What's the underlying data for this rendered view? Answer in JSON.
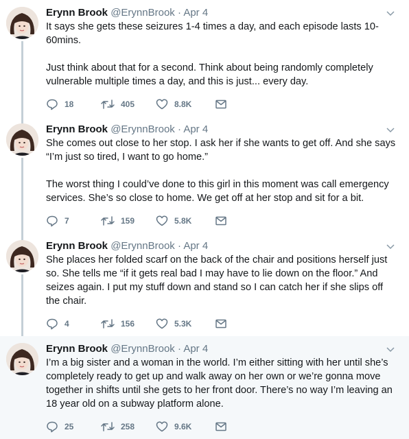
{
  "tweets": [
    {
      "name": "Erynn Brook",
      "handle": "@ErynnBrook",
      "separator": "·",
      "date": "Apr 4",
      "text": "It says she gets these seizures 1-4 times a day, and each episode lasts 10-60mins.\n\nJust think about that for a second. Think about being randomly completely vulnerable multiple times a day, and this is just... every day.",
      "replies": "18",
      "retweets": "405",
      "likes": "8.8K"
    },
    {
      "name": "Erynn Brook",
      "handle": "@ErynnBrook",
      "separator": "·",
      "date": "Apr 4",
      "text": "She comes out close to her stop. I ask her if she wants to get off. And she says “I’m just so tired, I want to go home.”\n\nThe worst thing I could’ve done to this girl in this moment was call emergency services. She’s so close to home. We get off at her stop and sit for a bit.",
      "replies": "7",
      "retweets": "159",
      "likes": "5.8K"
    },
    {
      "name": "Erynn Brook",
      "handle": "@ErynnBrook",
      "separator": "·",
      "date": "Apr 4",
      "text": "She places her folded scarf on the back of the chair and positions herself just so. She tells me “if it gets real bad I may have to lie down on the floor.” And seizes again. I put my stuff down and stand so I can catch her if she slips off the chair.",
      "replies": "4",
      "retweets": "156",
      "likes": "5.3K"
    },
    {
      "name": "Erynn Brook",
      "handle": "@ErynnBrook",
      "separator": "·",
      "date": "Apr 4",
      "text": "I’m a big sister and a woman in the world. I’m either sitting with her until she’s completely ready to get up and walk away on her own or we’re gonna move together in shifts until she gets to her front door. There’s no way I’m leaving an 18 year old on a subway platform alone.",
      "replies": "25",
      "retweets": "258",
      "likes": "9.6K"
    }
  ],
  "colors": {
    "text": "#14171a",
    "muted": "#657786",
    "thread_line": "#c4cfd6",
    "highlight_bg": "#f5f8fa"
  },
  "icons": [
    "reply-icon",
    "retweet-icon",
    "like-icon",
    "message-icon",
    "chevron-down-icon"
  ]
}
